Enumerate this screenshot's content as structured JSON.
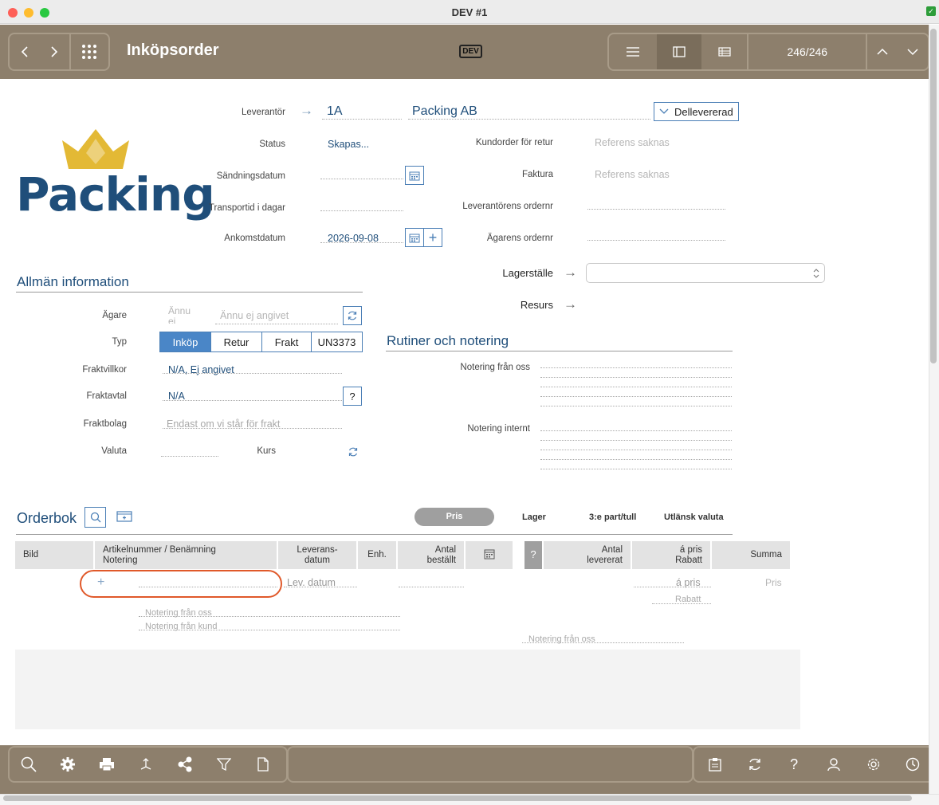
{
  "window": {
    "title": "DEV #1"
  },
  "toolbar": {
    "title": "Inköpsorder",
    "badge": "DEV",
    "record_counter": "246/246"
  },
  "logo": {
    "text": "Packing",
    "colors": {
      "crown": "#e3b935",
      "text": "#1f4e7a"
    }
  },
  "header": {
    "leverantor_label": "Leverantör",
    "leverantor_code": "1A",
    "leverantor_name": "Packing AB",
    "delivery_status": "Dellevererad",
    "status_label": "Status",
    "status_value": "Skapas...",
    "sandningsdatum_label": "Sändningsdatum",
    "transportid_label": "Transportid i dagar",
    "ankomstdatum_label": "Ankomstdatum",
    "ankomstdatum_value": "2026-09-08",
    "kundorder_label": "Kundorder för retur",
    "kundorder_value": "Referens saknas",
    "faktura_label": "Faktura",
    "faktura_value": "Referens saknas",
    "lev_ordernr_label": "Leverantörens ordernr",
    "agarens_ordernr_label": "Ägarens ordernr",
    "lagerstalle_label": "Lagerställe",
    "resurs_label": "Resurs"
  },
  "allman": {
    "title": "Allmän information",
    "agare_label": "Ägare",
    "agare_value1": "Ännu ej",
    "agare_value2": "Ännu ej angivet",
    "typ_label": "Typ",
    "typ_options": [
      "Inköp",
      "Retur",
      "Frakt",
      "UN3373"
    ],
    "fraktvillkor_label": "Fraktvillkor",
    "fraktvillkor_value": "N/A, Ej angivet",
    "fraktavtal_label": "Fraktavtal",
    "fraktavtal_value": "N/A",
    "fraktbolag_label": "Fraktbolag",
    "fraktbolag_placeholder": "Endast om vi står för frakt",
    "valuta_label": "Valuta",
    "kurs_label": "Kurs"
  },
  "rutiner": {
    "title": "Rutiner och notering",
    "notering_oss_label": "Notering från oss",
    "notering_internt_label": "Notering internt"
  },
  "orderbok": {
    "title": "Orderbok",
    "tabs": [
      "Pris",
      "Lager",
      "3:e part/tull",
      "Utlänsk valuta"
    ],
    "columns": {
      "bild": "Bild",
      "artikel1": "Artikelnummer / Benämning",
      "artikel2": "Notering",
      "lev1": "Leverans-",
      "lev2": "datum",
      "enh": "Enh.",
      "antal_best1": "Antal",
      "antal_best2": "beställt",
      "q": "?",
      "antal_lev1": "Antal",
      "antal_lev2": "levererat",
      "apris1": "á pris",
      "apris2": "Rabatt",
      "summa": "Summa"
    },
    "row": {
      "add": "+",
      "lev_datum": "Lev. datum",
      "apris": "á pris",
      "rabatt": "Rabatt",
      "pris": "Pris",
      "notering_oss": "Notering från oss",
      "notering_kund": "Notering från kund",
      "notering_oss2": "Notering från oss"
    }
  },
  "colors": {
    "toolbar": "#8d7f6c",
    "accent": "#4a86c7",
    "highlight_ring": "#e0592a"
  }
}
